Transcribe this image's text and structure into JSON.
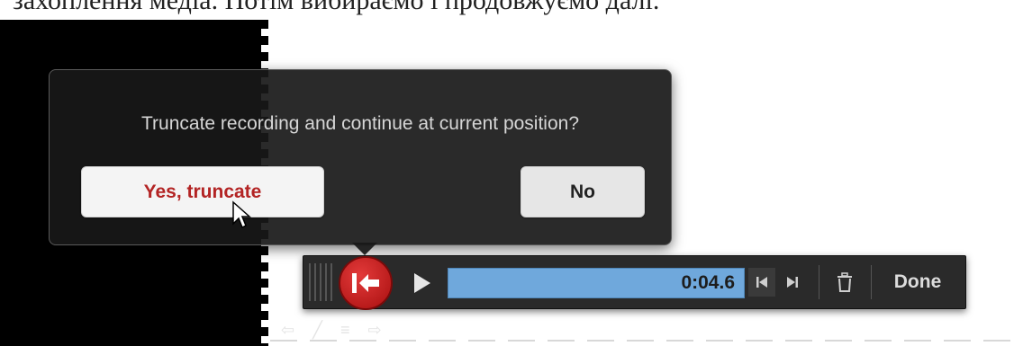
{
  "top_cutoff_text": "захоплення медіа. Потім вибираємо і продовжуємо далі.",
  "dialog": {
    "message": "Truncate recording and continue at current position?",
    "yes_label": "Yes, truncate",
    "no_label": "No"
  },
  "toolbar": {
    "time": "0:04.6",
    "progress_fraction": 1.0,
    "done_label": "Done"
  },
  "colors": {
    "dialog_bg": "#181818",
    "yes_text": "#b32424",
    "record_red": "#c81e1e",
    "progress_blue": "#6fa8dc",
    "toolbar_bg": "#2a2a2a"
  },
  "icons": {
    "record": "truncate-arrow-icon",
    "play": "play-icon",
    "skip_start": "skip-to-start-icon",
    "skip_end": "skip-to-end-icon",
    "trash": "trash-icon",
    "cursor": "mouse-pointer-icon"
  }
}
